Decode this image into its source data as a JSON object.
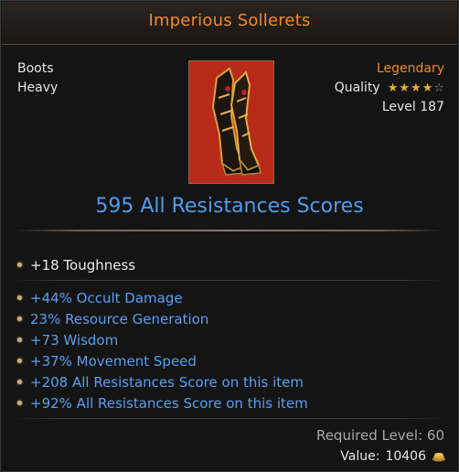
{
  "item": {
    "name": "Imperious Sollerets",
    "slot": "Boots",
    "weight": "Heavy",
    "rarity": "Legendary",
    "quality_label": "Quality",
    "quality_stars": 4,
    "quality_max": 5,
    "level": "Level 187",
    "icon": "boots-icon"
  },
  "headline": "595 All Resistances Scores",
  "implicit": [
    "+18 Toughness"
  ],
  "affixes": [
    "+44% Occult Damage",
    "23% Resource Generation",
    "+73 Wisdom",
    "+37% Movement Speed",
    "+208 All Resistances Score on this item",
    "+92% All Resistances Score on this item"
  ],
  "footer": {
    "required_level": "Required Level: 60",
    "value_label": "Value:",
    "value": "10406",
    "currency_icon": "gold-coin-icon"
  },
  "colors": {
    "title": "#f08a2c",
    "legendary": "#f08a2c",
    "magic_blue": "#5a9ff0",
    "star_gold": "#e4b130",
    "item_background": "#b82a18"
  }
}
